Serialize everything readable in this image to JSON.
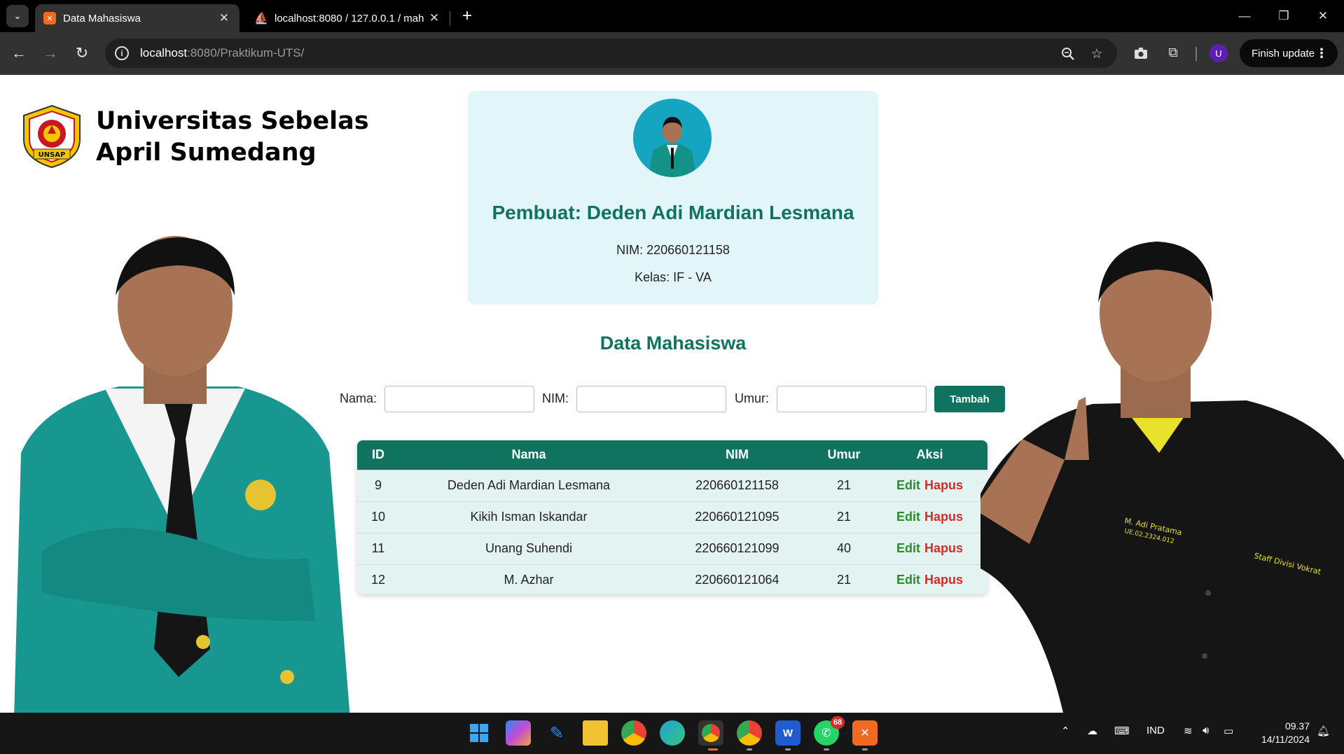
{
  "browser": {
    "tabs": [
      {
        "title": "Data Mahasiswa",
        "active": true,
        "icon": "xampp-icon"
      },
      {
        "title": "localhost:8080 / 127.0.0.1 / mah",
        "active": false,
        "icon": "phpmyadmin-icon"
      }
    ],
    "new_tab": "+",
    "url_host": "localhost",
    "url_path": ":8080/Praktikum-UTS/",
    "profile_initial": "U",
    "finish_update_label": "Finish update"
  },
  "page": {
    "university_name": "Universitas Sebelas April Sumedang",
    "logo_text": "UNSAP",
    "creator": "Pembuat: Deden Adi Mardian Lesmana",
    "nim_line": "NIM: 220660121158",
    "kelas_line": "Kelas: IF - VA",
    "section_title": "Data Mahasiswa",
    "form": {
      "nama_label": "Nama:",
      "nim_label": "NIM:",
      "umur_label": "Umur:",
      "nama_value": "",
      "nim_value": "",
      "umur_value": "",
      "submit_label": "Tambah"
    },
    "table": {
      "headers": [
        "ID",
        "Nama",
        "NIM",
        "Umur",
        "Aksi"
      ],
      "edit_label": "Edit",
      "delete_label": "Hapus",
      "rows": [
        {
          "id": "9",
          "nama": "Deden Adi Mardian Lesmana",
          "nim": "220660121158",
          "umur": "21"
        },
        {
          "id": "10",
          "nama": "Kikih Isman Iskandar",
          "nim": "220660121095",
          "umur": "21"
        },
        {
          "id": "11",
          "nama": "Unang Suhendi",
          "nim": "220660121099",
          "umur": "40"
        },
        {
          "id": "12",
          "nama": "M. Azhar",
          "nim": "220660121064",
          "umur": "21"
        }
      ]
    },
    "shirt_text_1": "M. Adi Pratama",
    "shirt_text_2": "UE.02.2324.012",
    "shirt_text_3": "Staff Divisi Vokrat"
  },
  "taskbar": {
    "badge_whatsapp": "68",
    "language": "IND",
    "time": "09.37",
    "date": "14/11/2024"
  },
  "colors": {
    "accent": "#10735f",
    "card_bg": "#e2f6fa",
    "edit": "#2e8b2e",
    "delete": "#d12b2b"
  }
}
